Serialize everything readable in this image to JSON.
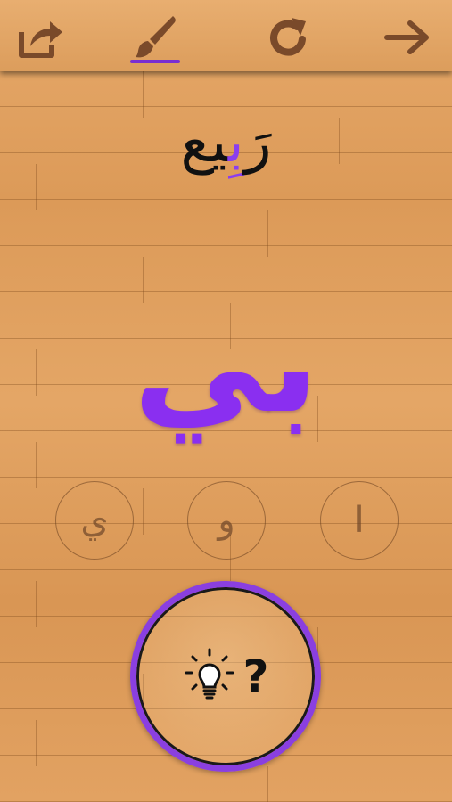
{
  "toolbar": {
    "share_icon": "share-icon",
    "brush_icon": "brush-icon",
    "reload_icon": "reload-icon",
    "next_icon": "arrow-right-icon",
    "icon_color": "#7a4a2a",
    "accent_color": "#7a2fd1"
  },
  "word": {
    "prefix": "رَ",
    "highlight": "بِ",
    "suffix": "يع"
  },
  "letter": "بي",
  "options": [
    "ي",
    "و",
    "ا"
  ],
  "hint": {
    "icon": "lightbulb-icon",
    "label": "?"
  },
  "colors": {
    "letter": "#8a2ff0",
    "ring": "#8a3fe0"
  }
}
